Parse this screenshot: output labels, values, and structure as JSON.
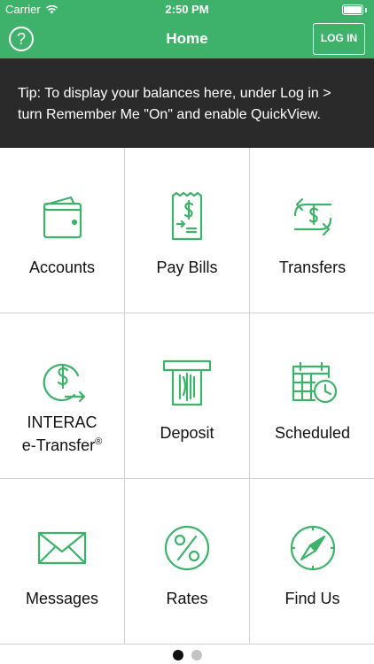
{
  "status_bar": {
    "carrier": "Carrier",
    "time": "2:50 PM"
  },
  "nav": {
    "help_label": "?",
    "title": "Home",
    "login_label": "LOG IN"
  },
  "tip": {
    "text": "Tip: To display your balances here, under Log in > turn Remember Me \"On\" and enable QuickView."
  },
  "tiles": [
    {
      "label": "Accounts",
      "icon": "wallet-icon"
    },
    {
      "label": "Pay Bills",
      "icon": "bill-icon"
    },
    {
      "label": "Transfers",
      "icon": "transfer-icon"
    },
    {
      "label_line1": "INTERAC",
      "label_line2": "e-Transfer",
      "label_sup": "®",
      "icon": "etransfer-icon"
    },
    {
      "label": "Deposit",
      "icon": "atm-deposit-icon"
    },
    {
      "label": "Scheduled",
      "icon": "calendar-clock-icon"
    },
    {
      "label": "Messages",
      "icon": "envelope-icon"
    },
    {
      "label": "Rates",
      "icon": "percent-icon"
    },
    {
      "label": "Find Us",
      "icon": "compass-icon"
    }
  ],
  "pager": {
    "pages": 2,
    "current": 1
  },
  "colors": {
    "brand_green": "#3eb26a",
    "tip_background": "#2a2a2a",
    "grid_border": "#d0d0d0"
  }
}
